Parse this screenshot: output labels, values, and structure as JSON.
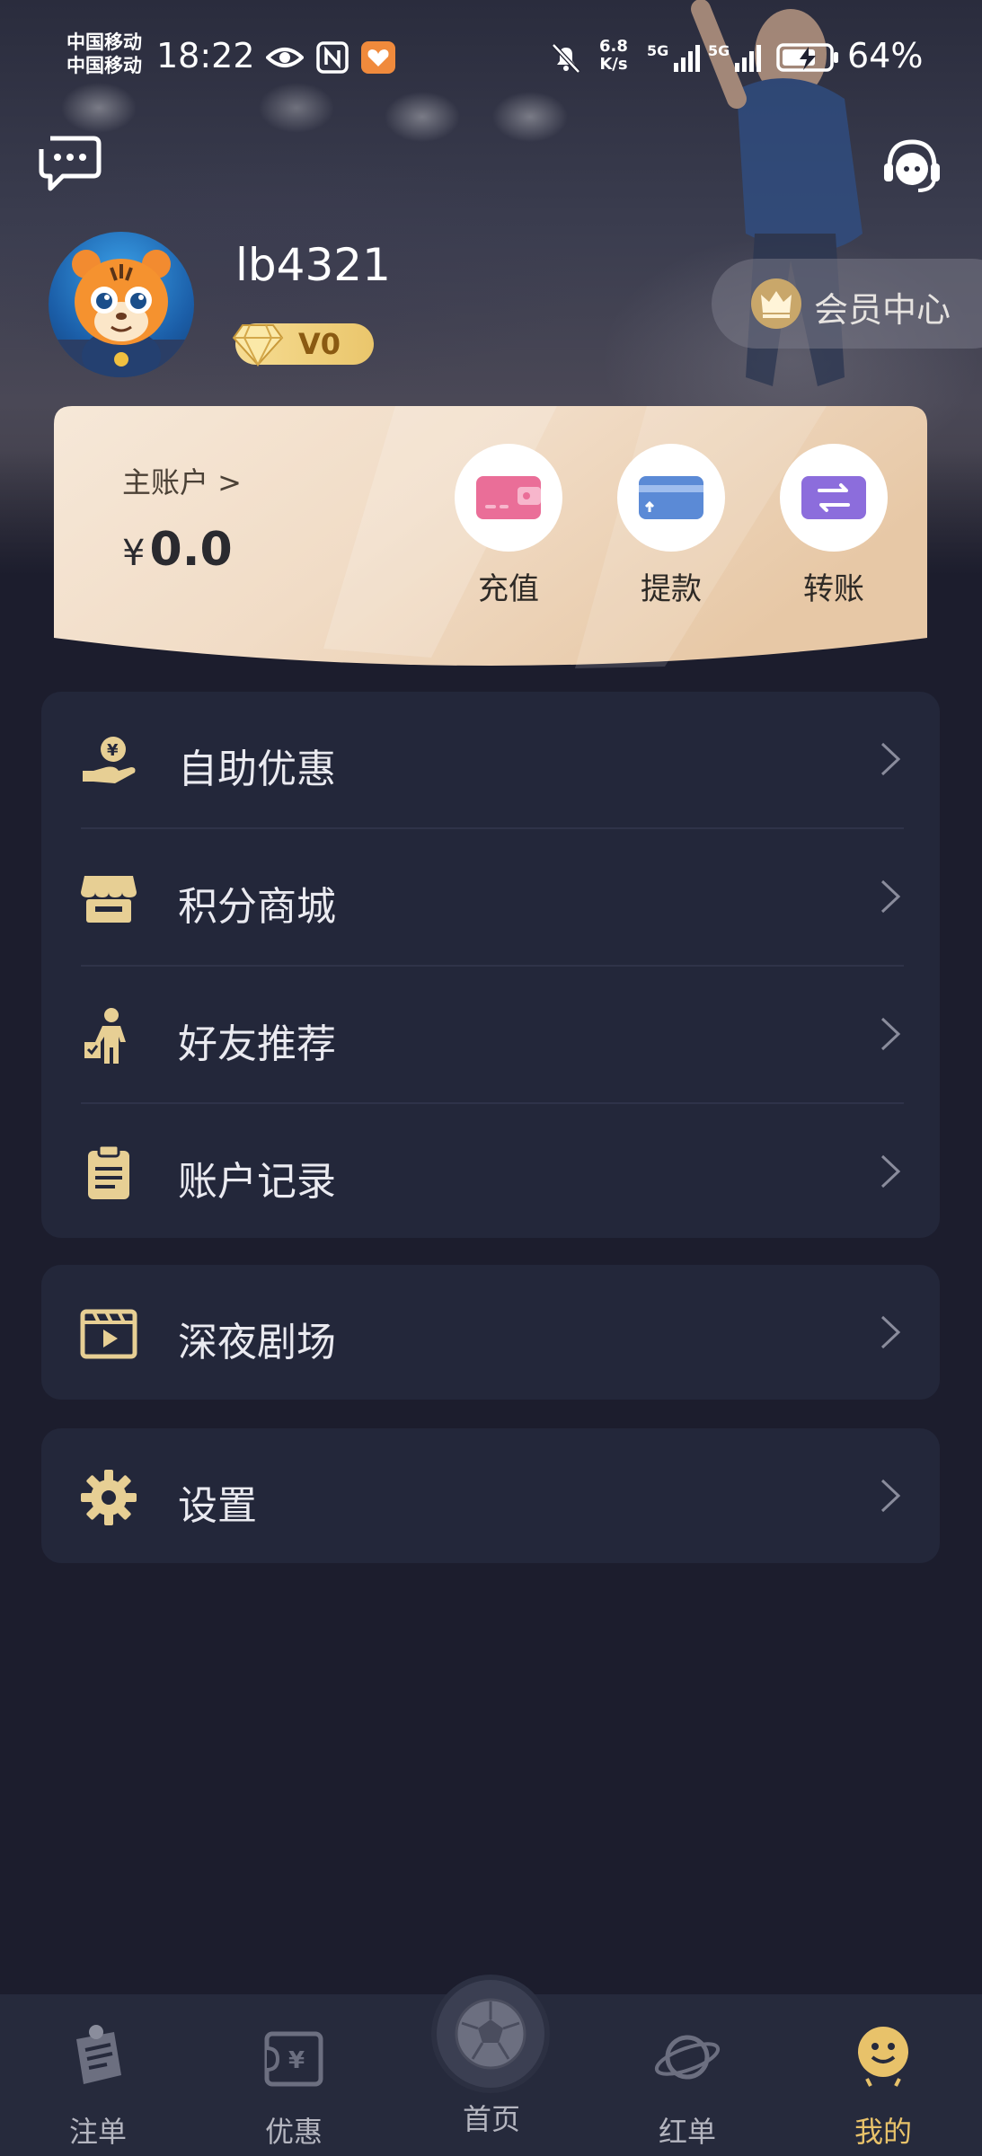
{
  "status_bar": {
    "carrier_1": "中国移动",
    "carrier_2": "中国移动",
    "time": "18:22",
    "net_speed_value": "6.8",
    "net_speed_unit": "K/s",
    "signal_1": "5G",
    "signal_2": "5G",
    "battery": "64%"
  },
  "profile": {
    "username": "lb4321",
    "vip_level": "V0",
    "member_center": "会员中心"
  },
  "wallet": {
    "account_link": "主账户 >",
    "currency": "¥",
    "balance": "0.0",
    "actions": [
      {
        "label": "充值",
        "icon": "wallet-icon",
        "color": "#ea6e98"
      },
      {
        "label": "提款",
        "icon": "card-withdraw-icon",
        "color": "#5b8ad6"
      },
      {
        "label": "转账",
        "icon": "transfer-icon",
        "color": "#8c6ddc"
      }
    ]
  },
  "menu": {
    "group1": [
      {
        "label": "自助优惠",
        "icon": "hand-coin-icon"
      },
      {
        "label": "积分商城",
        "icon": "store-icon"
      },
      {
        "label": "好友推荐",
        "icon": "refer-friend-icon"
      },
      {
        "label": "账户记录",
        "icon": "clipboard-icon"
      }
    ],
    "group2": [
      {
        "label": "深夜剧场",
        "icon": "video-icon"
      }
    ],
    "group3": [
      {
        "label": "设置",
        "icon": "gear-icon"
      }
    ]
  },
  "bottom_nav": [
    {
      "label": "注单",
      "icon": "bet-slip-icon",
      "active": false
    },
    {
      "label": "优惠",
      "icon": "voucher-icon",
      "active": false
    },
    {
      "label": "首页",
      "icon": "football-icon",
      "active": false
    },
    {
      "label": "红单",
      "icon": "planet-icon",
      "active": false
    },
    {
      "label": "我的",
      "icon": "smiley-icon",
      "active": true
    }
  ],
  "colors": {
    "background": "#1c1d2d",
    "card": "#23273a",
    "accent_gold": "#e8c26a",
    "icon_gold": "#e7cf94"
  }
}
